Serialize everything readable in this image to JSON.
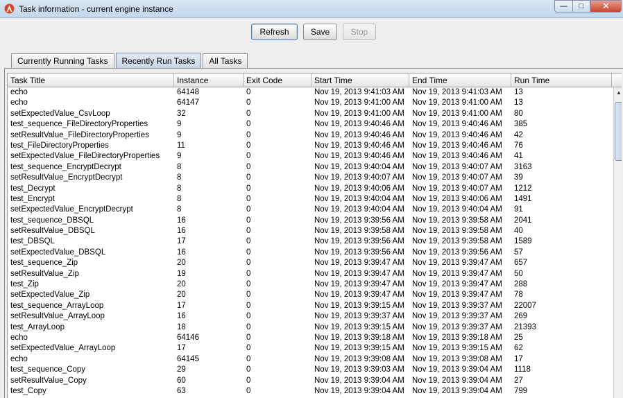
{
  "window": {
    "title": "Task information - current engine instance",
    "controls": {
      "minimize": "—",
      "maximize": "□",
      "close": "✕"
    }
  },
  "toolbar": {
    "refresh_label": "Refresh",
    "save_label": "Save",
    "stop_label": "Stop"
  },
  "tabs": [
    {
      "label": "Currently Running Tasks",
      "active": false
    },
    {
      "label": "Recently Run Tasks",
      "active": true
    },
    {
      "label": "All Tasks",
      "active": false
    }
  ],
  "table": {
    "columns": [
      "Task Title",
      "Instance",
      "Exit Code",
      "Start Time",
      "End Time",
      "Run Time"
    ],
    "rows": [
      [
        "echo",
        "64148",
        "0",
        "Nov 19, 2013 9:41:03 AM",
        "Nov 19, 2013 9:41:03 AM",
        "13"
      ],
      [
        "echo",
        "64147",
        "0",
        "Nov 19, 2013 9:41:00 AM",
        "Nov 19, 2013 9:41:00 AM",
        "13"
      ],
      [
        "setExpectedValue_CsvLoop",
        "32",
        "0",
        "Nov 19, 2013 9:41:00 AM",
        "Nov 19, 2013 9:41:00 AM",
        "80"
      ],
      [
        "test_sequence_FileDirectoryProperties",
        "9",
        "0",
        "Nov 19, 2013 9:40:46 AM",
        "Nov 19, 2013 9:40:46 AM",
        "385"
      ],
      [
        "setResultValue_FileDirectoryProperties",
        "9",
        "0",
        "Nov 19, 2013 9:40:46 AM",
        "Nov 19, 2013 9:40:46 AM",
        "42"
      ],
      [
        "test_FileDirectoryProperties",
        "11",
        "0",
        "Nov 19, 2013 9:40:46 AM",
        "Nov 19, 2013 9:40:46 AM",
        "76"
      ],
      [
        "setExpectedValue_FileDirectoryProperties",
        "9",
        "0",
        "Nov 19, 2013 9:40:46 AM",
        "Nov 19, 2013 9:40:46 AM",
        "41"
      ],
      [
        "test_sequence_EncryptDecrypt",
        "8",
        "0",
        "Nov 19, 2013 9:40:04 AM",
        "Nov 19, 2013 9:40:07 AM",
        "3163"
      ],
      [
        "setResultValue_EncryptDecrypt",
        "8",
        "0",
        "Nov 19, 2013 9:40:07 AM",
        "Nov 19, 2013 9:40:07 AM",
        "39"
      ],
      [
        "test_Decrypt",
        "8",
        "0",
        "Nov 19, 2013 9:40:06 AM",
        "Nov 19, 2013 9:40:07 AM",
        "1212"
      ],
      [
        "test_Encrypt",
        "8",
        "0",
        "Nov 19, 2013 9:40:04 AM",
        "Nov 19, 2013 9:40:06 AM",
        "1491"
      ],
      [
        "setExpectedValue_EncryptDecrypt",
        "8",
        "0",
        "Nov 19, 2013 9:40:04 AM",
        "Nov 19, 2013 9:40:04 AM",
        "91"
      ],
      [
        "test_sequence_DBSQL",
        "16",
        "0",
        "Nov 19, 2013 9:39:56 AM",
        "Nov 19, 2013 9:39:58 AM",
        "2041"
      ],
      [
        "setResultValue_DBSQL",
        "16",
        "0",
        "Nov 19, 2013 9:39:58 AM",
        "Nov 19, 2013 9:39:58 AM",
        "40"
      ],
      [
        "test_DBSQL",
        "17",
        "0",
        "Nov 19, 2013 9:39:56 AM",
        "Nov 19, 2013 9:39:58 AM",
        "1589"
      ],
      [
        "setExpectedValue_DBSQL",
        "16",
        "0",
        "Nov 19, 2013 9:39:56 AM",
        "Nov 19, 2013 9:39:56 AM",
        "57"
      ],
      [
        "test_sequence_Zip",
        "20",
        "0",
        "Nov 19, 2013 9:39:47 AM",
        "Nov 19, 2013 9:39:47 AM",
        "657"
      ],
      [
        "setResultValue_Zip",
        "19",
        "0",
        "Nov 19, 2013 9:39:47 AM",
        "Nov 19, 2013 9:39:47 AM",
        "50"
      ],
      [
        "test_Zip",
        "20",
        "0",
        "Nov 19, 2013 9:39:47 AM",
        "Nov 19, 2013 9:39:47 AM",
        "288"
      ],
      [
        "setExpectedValue_Zip",
        "20",
        "0",
        "Nov 19, 2013 9:39:47 AM",
        "Nov 19, 2013 9:39:47 AM",
        "78"
      ],
      [
        "test_sequence_ArrayLoop",
        "17",
        "0",
        "Nov 19, 2013 9:39:15 AM",
        "Nov 19, 2013 9:39:37 AM",
        "22007"
      ],
      [
        "setResultValue_ArrayLoop",
        "16",
        "0",
        "Nov 19, 2013 9:39:37 AM",
        "Nov 19, 2013 9:39:37 AM",
        "269"
      ],
      [
        "test_ArrayLoop",
        "18",
        "0",
        "Nov 19, 2013 9:39:15 AM",
        "Nov 19, 2013 9:39:37 AM",
        "21393"
      ],
      [
        "echo",
        "64146",
        "0",
        "Nov 19, 2013 9:39:18 AM",
        "Nov 19, 2013 9:39:18 AM",
        "25"
      ],
      [
        "setExpectedValue_ArrayLoop",
        "17",
        "0",
        "Nov 19, 2013 9:39:15 AM",
        "Nov 19, 2013 9:39:15 AM",
        "62"
      ],
      [
        "echo",
        "64145",
        "0",
        "Nov 19, 2013 9:39:08 AM",
        "Nov 19, 2013 9:39:08 AM",
        "17"
      ],
      [
        "test_sequence_Copy",
        "29",
        "0",
        "Nov 19, 2013 9:39:03 AM",
        "Nov 19, 2013 9:39:04 AM",
        "1118"
      ],
      [
        "setResultValue_Copy",
        "60",
        "0",
        "Nov 19, 2013 9:39:04 AM",
        "Nov 19, 2013 9:39:04 AM",
        "27"
      ],
      [
        "test_Copy",
        "63",
        "0",
        "Nov 19, 2013 9:39:04 AM",
        "Nov 19, 2013 9:39:04 AM",
        "799"
      ]
    ]
  },
  "icons": {
    "app": "app-logo-icon",
    "scroll_up": "scroll-up-arrow-icon"
  }
}
